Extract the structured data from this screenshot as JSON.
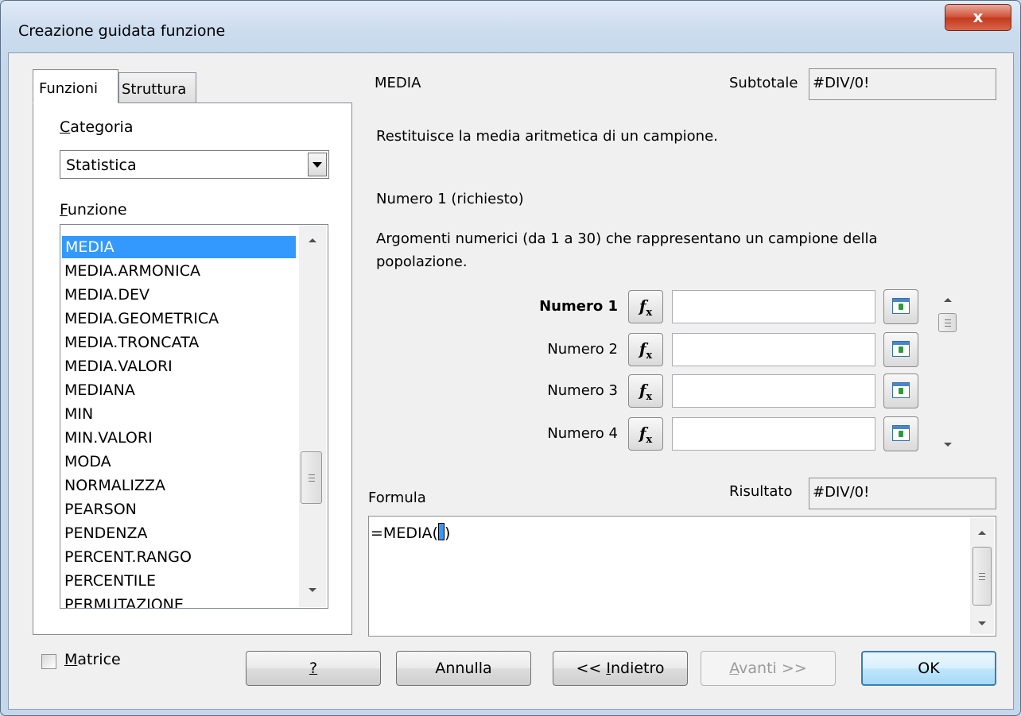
{
  "window": {
    "title": "Creazione guidata funzione",
    "close_glyph": "x"
  },
  "tabs": [
    {
      "label": "Funzioni"
    },
    {
      "label": "Struttura"
    }
  ],
  "category": {
    "label_accel": "C",
    "label_rest": "ategoria",
    "selected": "Statistica"
  },
  "function_list": {
    "label_accel": "F",
    "label_rest": "unzione",
    "selected": "MEDIA",
    "items": [
      "MEDIA",
      "MEDIA.ARMONICA",
      "MEDIA.DEV",
      "MEDIA.GEOMETRICA",
      "MEDIA.TRONCATA",
      "MEDIA.VALORI",
      "MEDIANA",
      "MIN",
      "MIN.VALORI",
      "MODA",
      "NORMALIZZA",
      "PEARSON",
      "PENDENZA",
      "PERCENT.RANGO",
      "PERCENTILE",
      "PERMUTAZIONE"
    ]
  },
  "function_info": {
    "name": "MEDIA",
    "subtotal_label": "Subtotale",
    "subtotal_value": "#DIV/0!",
    "description": "Restituisce la media aritmetica di un campione.",
    "arg_title": "Numero 1 (richiesto)",
    "arg_desc_line1": "Argomenti numerici (da 1 a 30) che rappresentano un campione della",
    "arg_desc_line2": "popolazione."
  },
  "arguments": [
    {
      "label": "Numero 1",
      "value": ""
    },
    {
      "label": "Numero 2",
      "value": ""
    },
    {
      "label": "Numero 3",
      "value": ""
    },
    {
      "label": "Numero 4",
      "value": ""
    }
  ],
  "fx_button": {
    "glyph": "f",
    "sub": "x"
  },
  "formula": {
    "label": "Formula",
    "text": "=MEDIA(",
    "text_after": ")",
    "result_label": "Risultato",
    "result_value": "#DIV/0!"
  },
  "matrix": {
    "accel": "M",
    "rest": "atrice",
    "checked": false
  },
  "buttons": {
    "help": "?",
    "cancel": "Annulla",
    "back_prefix": "<< ",
    "back_accel": "I",
    "back_rest": "ndietro",
    "next_accel": "A",
    "next_rest": "vanti >>",
    "ok": "OK"
  },
  "icons": [
    "close-icon",
    "dropdown-arrow-icon",
    "fx-icon",
    "shrink-icon",
    "scroll-up-icon",
    "scroll-down-icon"
  ]
}
